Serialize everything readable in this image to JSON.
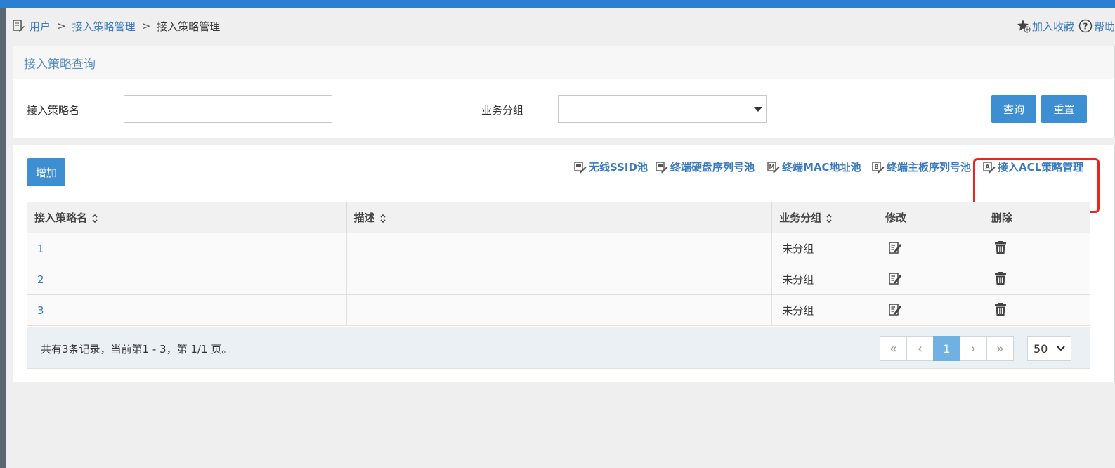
{
  "breadcrumb": {
    "items": [
      "用户",
      "接入策略管理"
    ],
    "current": "接入策略管理",
    "sep": ">"
  },
  "top_links": {
    "favorite": "加入收藏",
    "help": "帮助"
  },
  "query_panel": {
    "title": "接入策略查询",
    "name_label": "接入策略名",
    "name_value": "",
    "group_label": "业务分组",
    "group_value": "",
    "search_button": "查询",
    "reset_button": "重置"
  },
  "list_panel": {
    "add_button": "增加",
    "tool_links": [
      {
        "label": "无线SSID池",
        "icon": "ssid-pool-icon"
      },
      {
        "label": "终端硬盘序列号池",
        "icon": "disk-serial-pool-icon"
      },
      {
        "label": "终端MAC地址池",
        "icon": "mac-pool-icon"
      },
      {
        "label": "终端主板序列号池",
        "icon": "board-serial-pool-icon"
      },
      {
        "label": "接入ACL策略管理",
        "icon": "acl-policy-icon"
      }
    ],
    "columns": [
      "接入策略名",
      "描述",
      "业务分组",
      "修改",
      "删除"
    ],
    "rows": [
      {
        "name": "1",
        "desc": "",
        "group": "未分组"
      },
      {
        "name": "2",
        "desc": "",
        "group": "未分组"
      },
      {
        "name": "3",
        "desc": "",
        "group": "未分组"
      }
    ],
    "footer_info": "共有3条记录，当前第1 - 3，第 1/1 页。",
    "pager": {
      "first": "«",
      "prev": "‹",
      "current": "1",
      "next": "›",
      "last": "»"
    },
    "page_size": "50"
  },
  "colors": {
    "accent": "#3d8fd1",
    "link": "#3a7bbf",
    "highlight": "#e8261f",
    "topbar": "#2a7fd0"
  }
}
